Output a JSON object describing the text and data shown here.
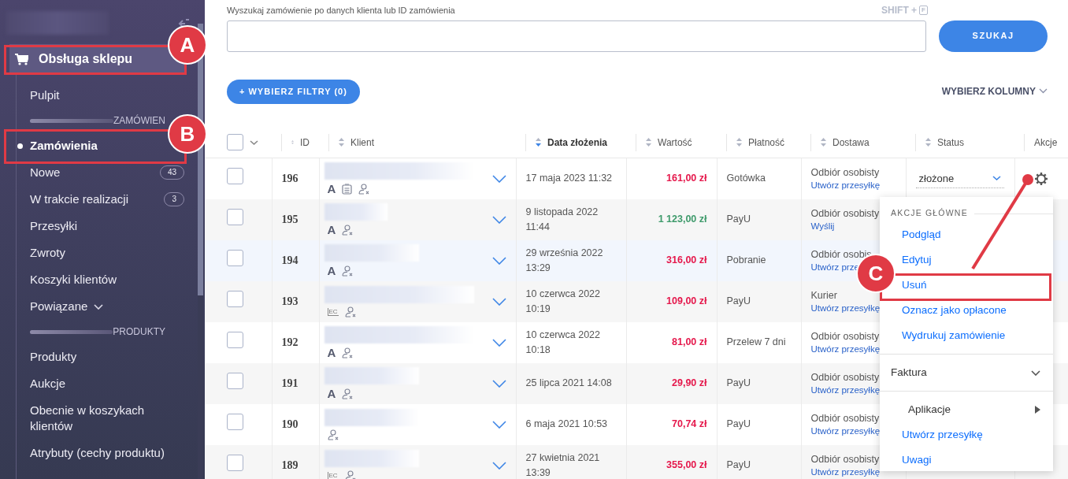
{
  "sidebar": {
    "title": "Obsługa sklepu",
    "items": [
      {
        "kind": "link",
        "label": "Pulpit",
        "selected": false
      },
      {
        "kind": "section",
        "label": "ZAMÓWIEN"
      },
      {
        "kind": "link",
        "label": "Zamówienia",
        "selected": true
      },
      {
        "kind": "link",
        "label": "Nowe",
        "selected": false,
        "count": "43"
      },
      {
        "kind": "link",
        "label": "W trakcie realizacji",
        "selected": false,
        "count": "3"
      },
      {
        "kind": "link",
        "label": "Przesyłki",
        "selected": false
      },
      {
        "kind": "link",
        "label": "Zwroty",
        "selected": false
      },
      {
        "kind": "link",
        "label": "Koszyki klientów",
        "selected": false
      },
      {
        "kind": "group",
        "label": "Powiązane",
        "selected": false,
        "expanded": false
      },
      {
        "kind": "section",
        "label": "PRODUKTY"
      },
      {
        "kind": "link",
        "label": "Produkty",
        "selected": false
      },
      {
        "kind": "link",
        "label": "Aukcje",
        "selected": false
      },
      {
        "kind": "link",
        "label": "Obecnie w koszykach klientów",
        "selected": false
      },
      {
        "kind": "link",
        "label": "Atrybuty (cechy produktu)",
        "selected": false
      }
    ]
  },
  "search": {
    "label": "Wyszukaj zamówienie po danych klienta lub ID zamówienia",
    "shortcut_prefix": "SHIFT +",
    "shortcut_key": "F",
    "button": "SZUKAJ"
  },
  "filters_button": "+ WYBIERZ FILTRY (0)",
  "columns_button": "WYBIERZ KOLUMNY",
  "table": {
    "select_all": {
      "checked": false
    },
    "columns": [
      {
        "label": "ID",
        "sortable": true,
        "sorted": false
      },
      {
        "label": "Klient",
        "sortable": true,
        "sorted": false
      },
      {
        "label": "Data złożenia",
        "sortable": true,
        "sorted": true
      },
      {
        "label": "Wartość",
        "sortable": true,
        "sorted": false
      },
      {
        "label": "Płatność",
        "sortable": true,
        "sorted": false
      },
      {
        "label": "Dostawa",
        "sortable": true,
        "sorted": false
      },
      {
        "label": "Status",
        "sortable": true,
        "sorted": false
      },
      {
        "label": "Akcje",
        "sortable": false,
        "sorted": false
      }
    ],
    "rows": [
      {
        "id": "196",
        "checked": false,
        "highlighted": false,
        "expanded": false,
        "badges": [
          {
            "kind": "letter",
            "text": "A"
          },
          {
            "kind": "clipboard"
          },
          {
            "kind": "user-x"
          }
        ],
        "date": "17 maja 2023 11:32",
        "value": "161,00 zł",
        "color": "#e5174b",
        "payment": "Gotówka",
        "delivery": "Odbiór osobisty",
        "delivery_link": "Utwórz przesyłkę",
        "status": "złożone"
      },
      {
        "id": "195",
        "checked": false,
        "highlighted": false,
        "expanded": false,
        "badges": [
          {
            "kind": "letter",
            "text": "A"
          },
          {
            "kind": "user-x"
          }
        ],
        "date": "9 listopada 2022 11:44",
        "value": "1 123,00 zł",
        "color": "#3e9a6b",
        "payment": "PayU",
        "delivery": "Odbiór osobisty",
        "delivery_link": "Wyślij"
      },
      {
        "id": "194",
        "checked": false,
        "highlighted": true,
        "expanded": false,
        "badges": [
          {
            "kind": "letter",
            "text": "A"
          },
          {
            "kind": "user-x"
          }
        ],
        "date": "29 września 2022 13:29",
        "value": "316,00 zł",
        "color": "#e5174b",
        "payment": "Pobranie",
        "delivery": "Odbiór osobis",
        "delivery_link": "Utwórz prze"
      },
      {
        "id": "193",
        "checked": false,
        "highlighted": false,
        "expanded": false,
        "badges": [
          {
            "kind": "letters",
            "text": "EC"
          },
          {
            "kind": "user-x"
          }
        ],
        "date": "10 czerwca 2022 10:19",
        "value": "109,00 zł",
        "color": "#e5174b",
        "payment": "PayU",
        "delivery": "Kurier",
        "delivery_link": "Utwórz przesyłkę"
      },
      {
        "id": "192",
        "checked": false,
        "highlighted": false,
        "expanded": false,
        "badges": [
          {
            "kind": "letter",
            "text": "A"
          },
          {
            "kind": "user-x"
          }
        ],
        "date": "10 czerwca 2022 10:18",
        "value": "81,00 zł",
        "color": "#e5174b",
        "payment": "Przelew 7 dni",
        "delivery": "Odbiór osobisty",
        "delivery_link": "Utwórz przesyłkę"
      },
      {
        "id": "191",
        "checked": false,
        "highlighted": false,
        "expanded": false,
        "badges": [
          {
            "kind": "letter",
            "text": "A"
          },
          {
            "kind": "user-x"
          }
        ],
        "date": "25 lipca 2021 14:08",
        "value": "29,90 zł",
        "color": "#e5174b",
        "payment": "PayU",
        "delivery": "Odbiór osobisty",
        "delivery_link": "Utwórz przesyłkę"
      },
      {
        "id": "190",
        "checked": false,
        "highlighted": false,
        "expanded": false,
        "badges": [
          {
            "kind": "user-x"
          }
        ],
        "date": "6 maja 2021 10:53",
        "value": "70,74 zł",
        "color": "#e5174b",
        "payment": "PayU",
        "delivery": "Odbiór osobisty",
        "delivery_link": "Utwórz przesyłkę"
      },
      {
        "id": "189",
        "checked": false,
        "highlighted": false,
        "expanded": false,
        "badges": [
          {
            "kind": "letters",
            "text": "EC"
          },
          {
            "kind": "user-x"
          }
        ],
        "date": "27 kwietnia 2021 13:39",
        "value": "355,00 zł",
        "color": "#e5174b",
        "payment": "PayU",
        "delivery": "Odbiór osobisty",
        "delivery_link": "Utwórz przesyłkę"
      }
    ]
  },
  "actions_menu": {
    "items": [
      {
        "kind": "heading",
        "label": "AKCJE GŁÓWNE"
      },
      {
        "kind": "link",
        "label": "Podgląd"
      },
      {
        "kind": "link",
        "label": "Edytuj"
      },
      {
        "kind": "link",
        "label": "Usuń"
      },
      {
        "kind": "link",
        "label": "Oznacz jako opłacone"
      },
      {
        "kind": "link",
        "label": "Wydrukuj zamówienie"
      },
      {
        "kind": "divider"
      },
      {
        "kind": "collapsible",
        "label": "Faktura",
        "expanded": false
      },
      {
        "kind": "divider"
      },
      {
        "kind": "submenu",
        "label": "Aplikacje"
      },
      {
        "kind": "link",
        "label": "Utwórz przesyłkę"
      },
      {
        "kind": "link",
        "label": "Uwagi"
      }
    ]
  },
  "annotations": [
    {
      "label": "A"
    },
    {
      "label": "B"
    },
    {
      "label": "C"
    }
  ]
}
